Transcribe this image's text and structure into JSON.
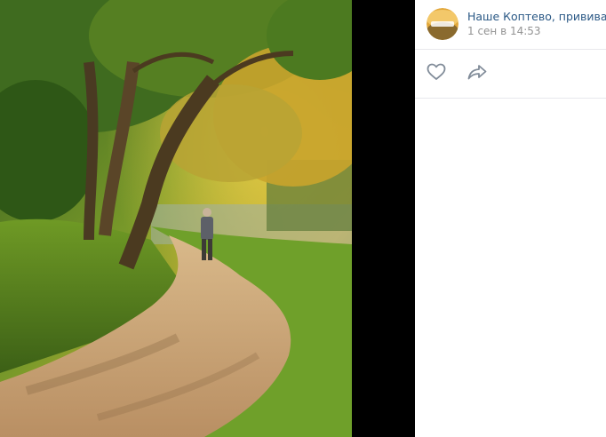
{
  "post": {
    "author": "Наше Коптево, прививайся!",
    "date": "1 сен в 14:53",
    "avatar_icon": "community-avatar"
  },
  "actions": {
    "like_icon": "heart-icon",
    "share_icon": "share-arrow-icon"
  },
  "photo": {
    "subject": "tree-lined-park-path"
  }
}
